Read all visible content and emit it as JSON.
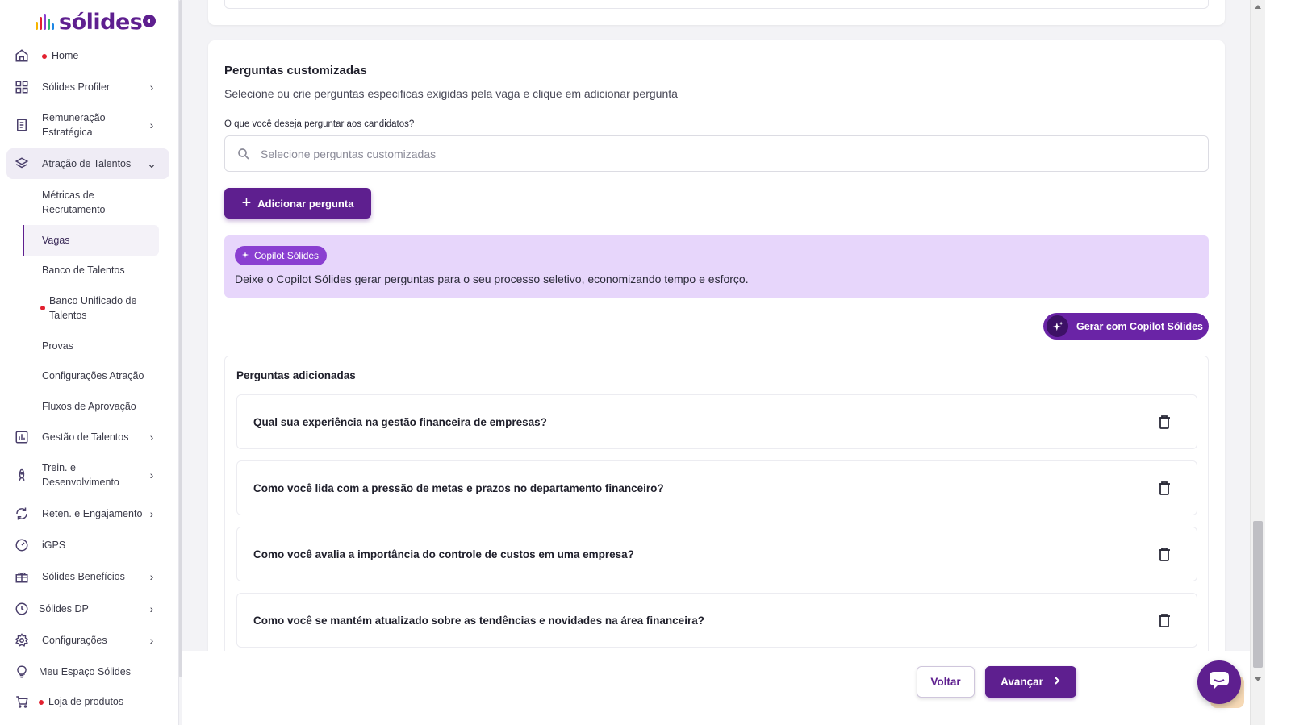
{
  "brand": {
    "name": "sólides",
    "primary_color": "#5e1f8f",
    "accent_color": "#8a3fd1",
    "copilot_bg": "#e7d6fb",
    "alert_dot_color": "#e2202f"
  },
  "sidebar": {
    "items": [
      {
        "label": "Home",
        "icon": "home-icon",
        "dot": true,
        "chevron": false
      },
      {
        "label": "Sólides Profiler",
        "icon": "grid-icon",
        "dot": false,
        "chevron": true
      },
      {
        "label": "Remuneração Estratégica",
        "icon": "document-money-icon",
        "dot": false,
        "chevron": true
      },
      {
        "label": "Atração de Talentos",
        "icon": "layers-icon",
        "dot": false,
        "chevron": true,
        "expanded": true
      },
      {
        "label": "Gestão de Talentos",
        "icon": "bar-chart-icon",
        "dot": false,
        "chevron": true
      },
      {
        "label": "Trein. e Desenvolvimento",
        "icon": "rocket-icon",
        "dot": false,
        "chevron": true
      },
      {
        "label": "Reten. e Engajamento",
        "icon": "refresh-icon",
        "dot": false,
        "chevron": true
      },
      {
        "label": "iGPS",
        "icon": "gauge-icon",
        "dot": false,
        "chevron": false
      },
      {
        "label": "Sólides Benefícios",
        "icon": "gift-icon",
        "dot": false,
        "chevron": true
      },
      {
        "label": "Sólides DP",
        "icon": "clock-icon",
        "dot": false,
        "chevron": true
      },
      {
        "label": "Configurações",
        "icon": "gear-icon",
        "dot": false,
        "chevron": true
      },
      {
        "label": "Meu Espaço Sólides",
        "icon": "lightbulb-icon",
        "dot": false,
        "chevron": false
      },
      {
        "label": "Loja de produtos",
        "icon": "cart-icon",
        "dot": true,
        "chevron": false
      }
    ],
    "sub_items": [
      {
        "label": "Métricas de Recrutamento"
      },
      {
        "label": "Vagas",
        "active": true
      },
      {
        "label": "Banco de Talentos"
      },
      {
        "label": "Banco Unificado de Talentos",
        "dot": true
      },
      {
        "label": "Provas"
      },
      {
        "label": "Configurações Atração"
      },
      {
        "label": "Fluxos de Aprovação"
      }
    ]
  },
  "main": {
    "title": "Perguntas customizadas",
    "subtitle": "Selecione ou crie perguntas especificas exigidas pela vaga e clique em adicionar pergunta",
    "question_label": "O que você deseja perguntar aos candidatos?",
    "search_placeholder": "Selecione perguntas customizadas",
    "add_button": "Adicionar pergunta",
    "copilot": {
      "badge": "Copilot Sólides",
      "text": "Deixe o Copilot Sólides gerar perguntas para o seu processo seletivo, economizando tempo e esforço.",
      "generate_button": "Gerar com Copilot Sólides"
    },
    "added": {
      "title": "Perguntas adicionadas",
      "questions": [
        "Qual sua experiência na gestão financeira de empresas?",
        "Como você lida com a pressão de metas e prazos no departamento financeiro?",
        "Como você avalia a importância do controle de custos em uma empresa?",
        "Como você se mantém atualizado sobre as tendências e novidades na área financeira?"
      ]
    }
  },
  "footer": {
    "back_button": "Voltar",
    "next_button": "Avançar"
  }
}
